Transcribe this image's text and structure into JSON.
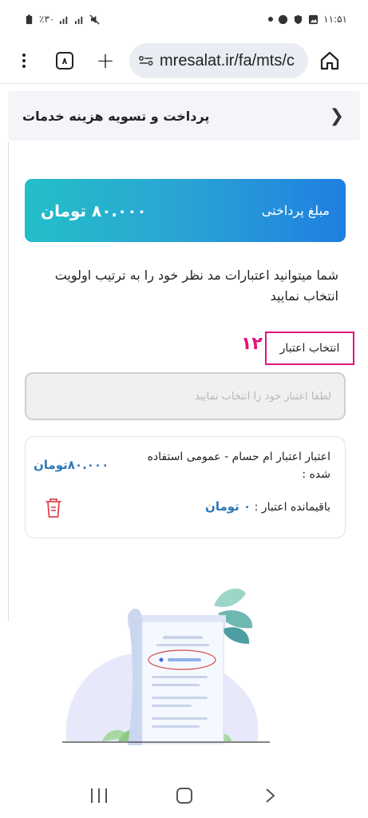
{
  "status_bar": {
    "left": "٪۳۰",
    "time": "۱۱:۵۱"
  },
  "browser": {
    "tab_count": "۸",
    "url": "mresalat.ir/fa/mts/c"
  },
  "page": {
    "title": "پرداخت و تسویه هزینه خدمات",
    "payment_label": "مبلغ پرداختی",
    "payment_amount": "۸۰.۰۰۰ تومان",
    "description": "شما میتوانید اعتبارات مد نظر خود را به ترتیب اولویت انتخاب نمایید",
    "step_number": "۱۲",
    "select_label": "انتخاب اعتبار",
    "select_placeholder": "لطفا اعتبار خود را انتخاب نمایید",
    "credit_item": {
      "title": "اعتبار اعتبار ام حسام - عمومی استفاده شده :",
      "price": "۸۰.۰۰۰تومان",
      "remaining_label": "باقیمانده اعتبار :",
      "remaining_value": "۰ تومان"
    }
  },
  "colors": {
    "accent_pink": "#e2157a",
    "value_blue": "#2e78b7",
    "trash_red": "#e0474c"
  }
}
